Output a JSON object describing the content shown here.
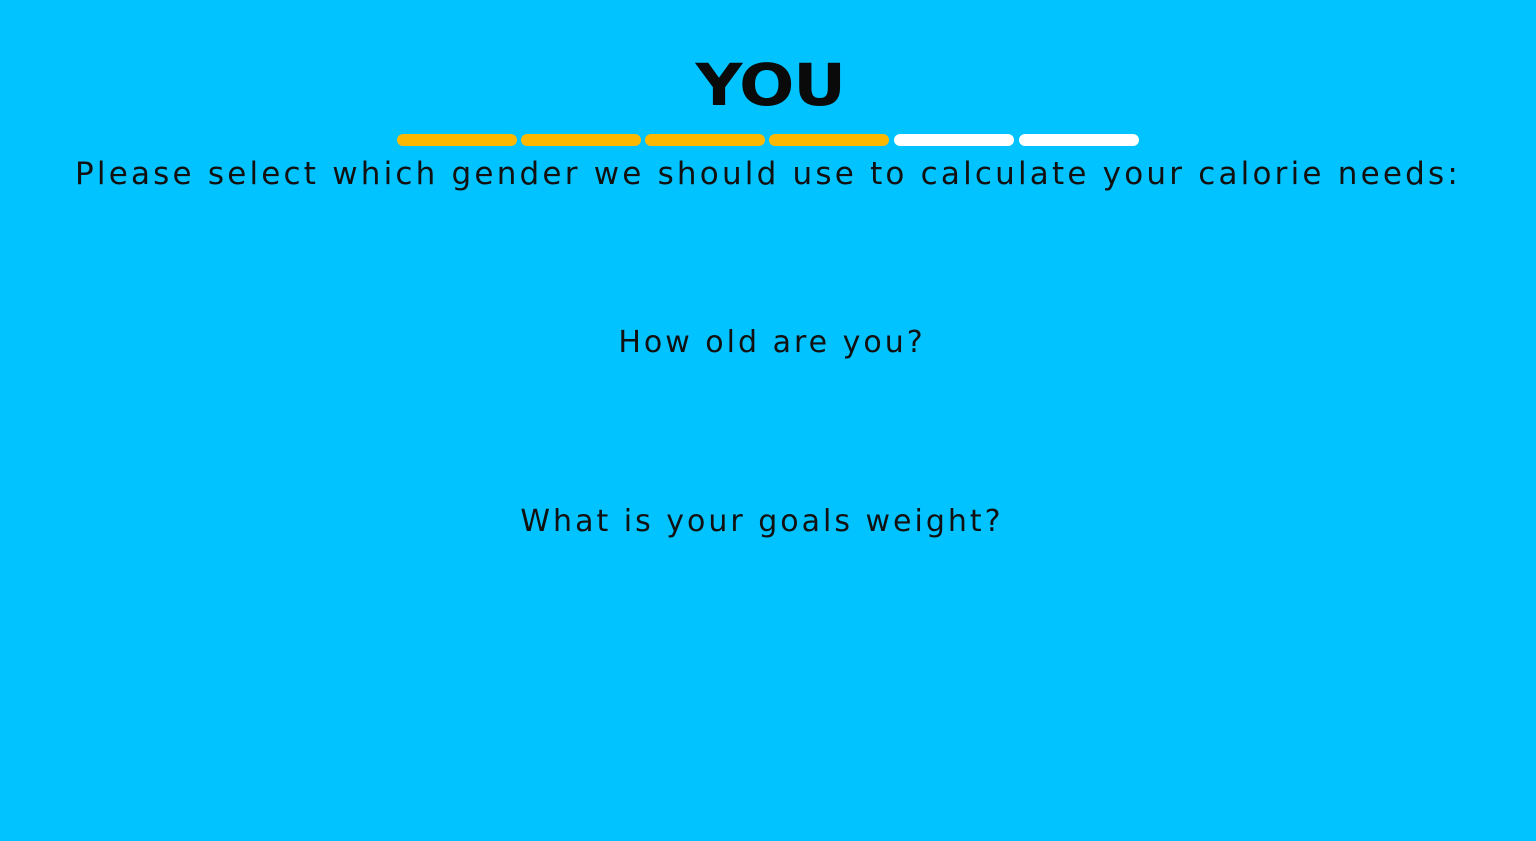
{
  "header": {
    "title": "YOU"
  },
  "progress": {
    "total_steps": 6,
    "completed_steps": 4,
    "colors": {
      "completed": "#ffb800",
      "remaining": "#ffffff"
    }
  },
  "questions": {
    "gender": "Please select which gender we should use to calculate your calorie needs:",
    "age": "How old are you?",
    "goal_weight": "What is your goals weight?"
  },
  "theme": {
    "background": "#00c3ff",
    "text": "#111111"
  }
}
